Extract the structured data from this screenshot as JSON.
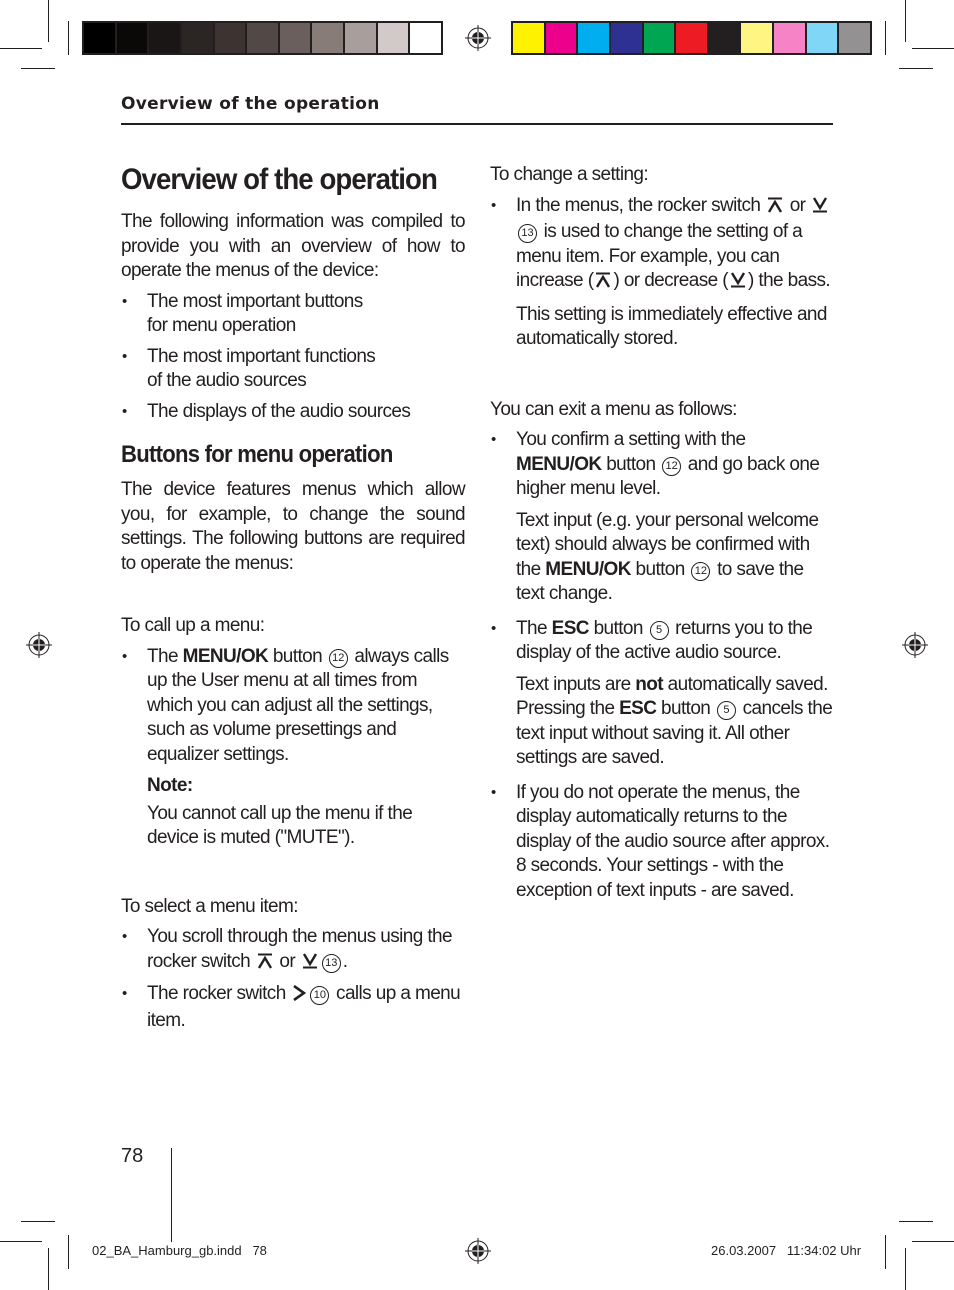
{
  "running_head": "Overview of the operation",
  "page_number": "78",
  "slug": {
    "file": "02_BA_Hamburg_gb.indd   78",
    "timestamp": "26.03.2007   11:34:02 Uhr"
  },
  "colorbars": {
    "grayscale": [
      "#000000",
      "#0b0908",
      "#1a1615",
      "#2b2523",
      "#3d3331",
      "#524846",
      "#6a5f5c",
      "#877c78",
      "#a89f9c",
      "#d2cac8",
      "#ffffff"
    ],
    "process": [
      "#fff200",
      "#ec008c",
      "#00aeef",
      "#2e3192",
      "#00a651",
      "#ed1c24",
      "#231f20",
      "#fff582",
      "#f583c6",
      "#7fd6f7",
      "#939191"
    ]
  },
  "left": {
    "title": "Overview of the operation",
    "intro": "The following information was compiled to provide you with an overview of how to operate the menus of the device:",
    "intro_bullets": [
      "The most important buttons for menu operation",
      "The most important functions of the audio sources",
      "The displays of the audio sources"
    ],
    "section_title": "Buttons for menu operation",
    "section_intro": "The device features menus which allow you, for example, to change the sound settings. The following buttons are required to operate the menus:",
    "call_up": {
      "heading": "To call up a menu:",
      "bullet": {
        "pre": "The ",
        "bold": "MENU/OK",
        "mid": " button",
        "ref": "12",
        "post": " always calls up the User menu at all times from which you can adjust all the settings, such as volume presettings and equalizer settings."
      },
      "note_label": "Note:",
      "note_text": "You cannot call up the menu if the device is muted (\"MUTE\")."
    },
    "select": {
      "heading": "To select a menu item:",
      "bullet1": {
        "pre": "You scroll through the menus using the rocker switch ",
        "or": " or ",
        "ref": "13",
        "post": "."
      },
      "bullet2": {
        "pre": "The rocker switch ",
        "ref": "10",
        "post": " calls up a menu item."
      }
    }
  },
  "right": {
    "change": {
      "heading": "To change a setting:",
      "bullet": {
        "pre": "In the menus, the rocker switch ",
        "or": " or ",
        "ref": "13",
        "mid": " is used to change the setting of a menu item. For example, you can increase (",
        "mid2": ") or decrease (",
        "post": ") the bass."
      },
      "followup": "This setting is immediately effective and automatically stored."
    },
    "exit": {
      "heading": "You can exit a menu as follows:",
      "b1": {
        "pre": "You confirm a setting with the ",
        "bold": "MENU/OK",
        "mid": " button",
        "ref": "12",
        "post": " and go back one higher menu level.",
        "follow_pre": "Text input (e.g. your personal welcome text) should always be confirmed with the ",
        "follow_bold": "MENU/OK",
        "follow_mid": " button",
        "follow_ref": "12",
        "follow_post": " to save the text change."
      },
      "b2": {
        "pre": "The ",
        "bold": "ESC",
        "mid": " button",
        "ref": "5",
        "post": " returns you to the display of the active audio source.",
        "f_pre": "Text inputs are ",
        "f_bold": "not",
        "f_mid": " automatically saved. Pressing the ",
        "f_bold2": "ESC",
        "f_mid2": " button",
        "f_ref": "5",
        "f_post": " cancels the text input without saving it. All other settings are saved."
      },
      "b3": "If you do not operate the menus, the display automatically returns to the display of the audio source after approx. 8 seconds. Your settings - with the exception of text inputs - are saved."
    }
  },
  "icons": {
    "up": "rocker-up-icon",
    "down": "rocker-down-icon",
    "right": "rocker-right-icon"
  }
}
